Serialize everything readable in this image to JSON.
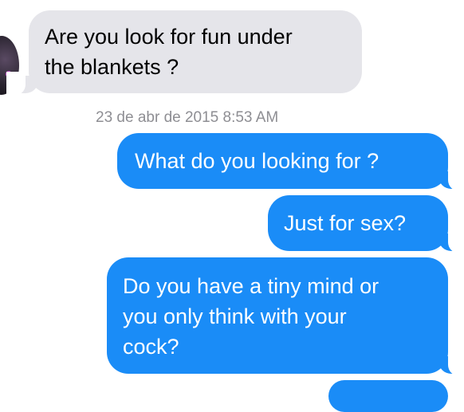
{
  "thread": {
    "timestamp": "23 de abr de 2015 8:53 AM",
    "messages": [
      {
        "from": "them",
        "lines": [
          "Are you look for fun under",
          "the blankets ?"
        ]
      },
      {
        "from": "me",
        "text": "What do you looking for ?"
      },
      {
        "from": "me",
        "text": "Just for sex?"
      },
      {
        "from": "me",
        "lines": [
          "Do you have a tiny mind or",
          "you only think with your",
          "cock?"
        ]
      }
    ]
  },
  "colors": {
    "received_bubble": "#e5e5ea",
    "sent_bubble": "#1a8cf7",
    "timestamp_text": "#8e8e93"
  }
}
